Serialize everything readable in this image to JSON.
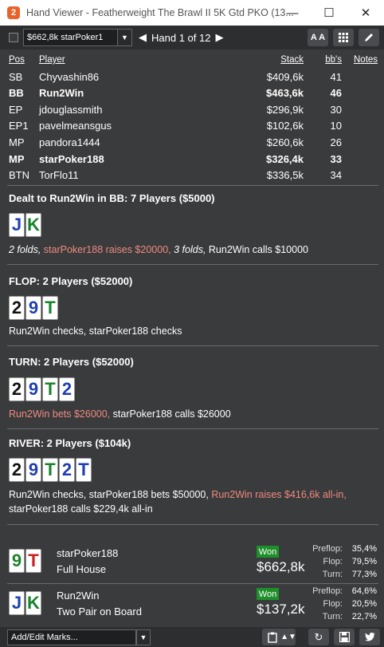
{
  "window": {
    "app_icon": "2",
    "title": "Hand Viewer - Featherweight The Brawl II  5K Gtd PKO (13...",
    "minimize": "—",
    "maximize": "☐",
    "close": "✕"
  },
  "toolbar": {
    "player_selected": "$662,8k starPoker1",
    "hand_label": "Hand 1 of 12",
    "font_button": "A A"
  },
  "players": {
    "headers": {
      "pos": "Pos",
      "player": "Player",
      "stack": "Stack",
      "bbs": "bb's",
      "notes": "Notes"
    },
    "rows": [
      {
        "pos": "SB",
        "name": "Chyvashin86",
        "stack": "$409,6k",
        "bbs": "41",
        "bold": false
      },
      {
        "pos": "BB",
        "name": "Run2Win",
        "stack": "$463,6k",
        "bbs": "46",
        "bold": true
      },
      {
        "pos": "EP",
        "name": "jdouglassmith",
        "stack": "$296,9k",
        "bbs": "30",
        "bold": false
      },
      {
        "pos": "EP1",
        "name": "pavelmeansgus",
        "stack": "$102,6k",
        "bbs": "10",
        "bold": false
      },
      {
        "pos": "MP",
        "name": "pandora1444",
        "stack": "$260,6k",
        "bbs": "26",
        "bold": false
      },
      {
        "pos": "MP",
        "name": "starPoker188",
        "stack": "$326,4k",
        "bbs": "33",
        "bold": true
      },
      {
        "pos": "BTN",
        "name": "TorFlo11",
        "stack": "$336,5k",
        "bbs": "34",
        "bold": false
      }
    ]
  },
  "preflop": {
    "title": "Dealt to Run2Win in BB: 7 Players ($5000)",
    "cards": [
      {
        "rank": "J",
        "suit": "diamond"
      },
      {
        "rank": "K",
        "suit": "club"
      }
    ],
    "actions": {
      "a1": "2 folds,",
      "a2": "starPoker188 raises $20000,",
      "a3": "3 folds,",
      "a4": "Run2Win calls $10000"
    }
  },
  "flop": {
    "title": "FLOP: 2 Players ($52000)",
    "cards": [
      {
        "rank": "2",
        "suit": "spade"
      },
      {
        "rank": "9",
        "suit": "diamond"
      },
      {
        "rank": "T",
        "suit": "club"
      }
    ],
    "action": "Run2Win checks, starPoker188 checks"
  },
  "turn": {
    "title": "TURN: 2 Players ($52000)",
    "cards": [
      {
        "rank": "2",
        "suit": "spade"
      },
      {
        "rank": "9",
        "suit": "diamond"
      },
      {
        "rank": "T",
        "suit": "club"
      },
      {
        "rank": "2",
        "suit": "diamond"
      }
    ],
    "actions": {
      "a1": "Run2Win bets $26000,",
      "a2": "starPoker188 calls $26000"
    }
  },
  "river": {
    "title": "RIVER: 2 Players ($104k)",
    "cards": [
      {
        "rank": "2",
        "suit": "spade"
      },
      {
        "rank": "9",
        "suit": "diamond"
      },
      {
        "rank": "T",
        "suit": "club"
      },
      {
        "rank": "2",
        "suit": "diamond"
      },
      {
        "rank": "T",
        "suit": "diamond"
      }
    ],
    "actions": {
      "a1": "Run2Win checks, starPoker188 bets $50000,",
      "a2": "Run2Win raises $416,6k all-in,",
      "a3": "starPoker188 calls $229,4k all-in"
    }
  },
  "results": [
    {
      "cards": [
        {
          "rank": "9",
          "suit": "club"
        },
        {
          "rank": "T",
          "suit": "heart"
        }
      ],
      "name": "starPoker188",
      "hand": "Full House",
      "badge": "Won",
      "amount": "$662,8k",
      "labels": {
        "preflop": "Preflop:",
        "flop": "Flop:",
        "turn": "Turn:"
      },
      "equity": {
        "preflop": "35,4%",
        "flop": "79,5%",
        "turn": "77,3%"
      }
    },
    {
      "cards": [
        {
          "rank": "J",
          "suit": "diamond"
        },
        {
          "rank": "K",
          "suit": "club"
        }
      ],
      "name": "Run2Win",
      "hand": "Two Pair on Board",
      "badge": "Won",
      "amount": "$137,2k",
      "labels": {
        "preflop": "Preflop:",
        "flop": "Flop:",
        "turn": "Turn:"
      },
      "equity": {
        "preflop": "64,6%",
        "flop": "20,5%",
        "turn": "22,7%"
      }
    }
  ],
  "bottom": {
    "marks_label": "Add/Edit Marks..."
  },
  "icons": {
    "app": "app-logo-icon",
    "dropdown": "chevron-down-icon",
    "prev": "prev-hand-icon",
    "next": "next-hand-icon",
    "font": "font-size-icon",
    "grid": "grid-icon",
    "edit": "pencil-icon",
    "clipboard": "clipboard-icon",
    "sort": "sort-icon",
    "replay": "replay-icon",
    "save": "save-icon",
    "twitter": "twitter-icon"
  }
}
